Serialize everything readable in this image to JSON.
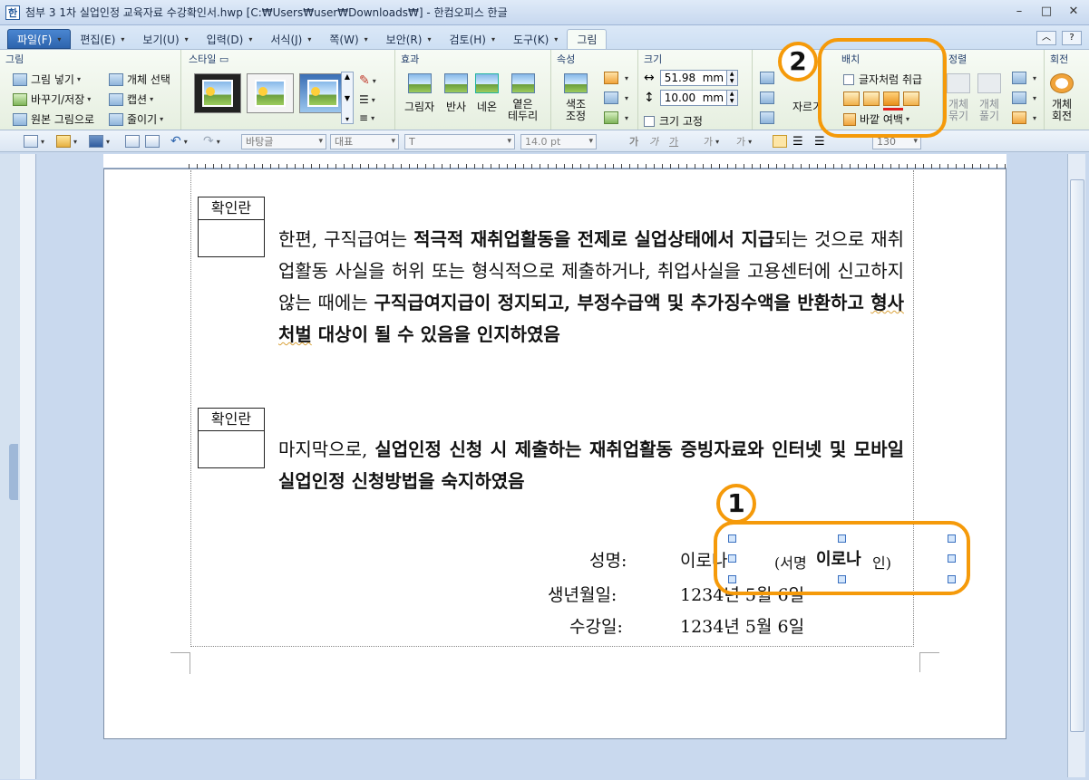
{
  "window": {
    "title": "첨부 3 1차 실업인정 교육자료 수강확인서.hwp [C:₩Users₩user₩Downloads₩] - 한컴오피스 한글",
    "controls": [
      "–",
      "□",
      "✕"
    ]
  },
  "menu": {
    "tabs": [
      {
        "label": "파일(F)"
      },
      {
        "label": "편집(E)"
      },
      {
        "label": "보기(U)"
      },
      {
        "label": "입력(D)"
      },
      {
        "label": "서식(J)"
      },
      {
        "label": "쪽(W)"
      },
      {
        "label": "보안(R)"
      },
      {
        "label": "검토(H)"
      },
      {
        "label": "도구(K)"
      },
      {
        "label": "그림"
      }
    ]
  },
  "ribbon": {
    "group_picture": {
      "title": "그림",
      "insert": "그림 넣기",
      "select_obj": "개체 선택",
      "replace_save": "바꾸기/저장",
      "caption": "캡션",
      "original": "원본 그림으로",
      "shrink": "줄이기"
    },
    "group_style": {
      "title": "스타일"
    },
    "group_effect": {
      "title": "효과",
      "shadow": "그림자",
      "reflect": "반사",
      "neon": "네온",
      "soft_edge_1": "옅은",
      "soft_edge_2": "테두리"
    },
    "group_props": {
      "title": "속성",
      "color_1": "색조",
      "color_2": "조정"
    },
    "group_size": {
      "title": "크기",
      "width": "51.98",
      "height": "10.00",
      "unit": "mm",
      "fix": "크기 고정"
    },
    "group_rotate_partial": {
      "label": "자르기"
    },
    "group_layout": {
      "title": "배치",
      "treat_as_char": "글자처럼 취급",
      "outer_margin": "바깥 여백"
    },
    "group_align": {
      "title": "정렬",
      "group_obj_1": "개체",
      "group_obj_2": "묶기",
      "ungroup_1": "개체",
      "ungroup_2": "풀기"
    },
    "group_rotate": {
      "title": "회전",
      "obj_rotate_1": "개체",
      "obj_rotate_2": "회전"
    }
  },
  "toolbar": {
    "style_combo": "바탕글",
    "lang_combo": "대표",
    "font_size": "14.0",
    "font_unit": "pt",
    "zoom": "130"
  },
  "document": {
    "check_label": "확인란",
    "para1": {
      "t1": "한편, 구직급여는 ",
      "t2": "적극적 재취업활동을 전제로 실업상태에서 지급",
      "t3": "되는 것으로 재취업활동 사실을 허위 또는 형식적으로 제출하거나, 취업사실을 고용센터에 신고하지 않는 때에는 ",
      "t4": "구직급여지급이 정지되고, 부정수급액 및 추가징수액을 반환하고 ",
      "t5": "형사처벌",
      "t6": " 대상이 될 수 있음을 인지하였음"
    },
    "para2": {
      "t1": "마지막으로, ",
      "t2": "실업인정 신청 시 제출하는 재취업활동 증빙자료와 인터넷 및 모바일 실업인정 신청방법을 숙지하였음"
    },
    "sign": {
      "name_label": "성명:",
      "name_value": "이로나",
      "sig_open": "(서명",
      "sig_image_text": "이로나",
      "sig_close": "인)",
      "birth_label": "생년월일:",
      "birth_value": "1234년 5월 6일",
      "date_label": "수강일:",
      "date_value": "1234년 5월 6일"
    }
  },
  "callouts": {
    "one": "1",
    "two": "2"
  },
  "colors": {
    "callout": "#f59a0a",
    "selection_handle": "#3a70c0"
  }
}
